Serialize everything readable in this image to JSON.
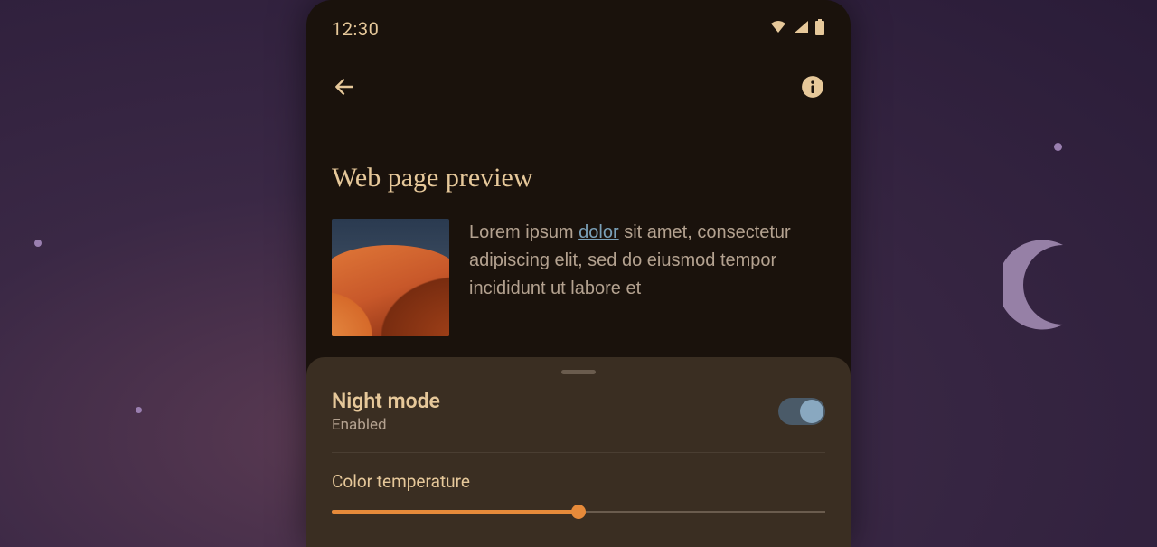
{
  "status": {
    "time": "12:30"
  },
  "page": {
    "title": "Web page preview",
    "body_pre": "Lorem ipsum ",
    "body_link": "dolor",
    "body_post": " sit amet, consectetur adipiscing elit, sed do eiusmod tempor incididunt ut labore et"
  },
  "sheet": {
    "title": "Night mode",
    "status": "Enabled",
    "toggle_on": true,
    "temp_label": "Color temperature",
    "temp_percent": 50
  },
  "icons": {
    "back": "back-arrow",
    "info": "info",
    "wifi": "wifi",
    "signal": "cellular-signal",
    "battery": "battery-full"
  },
  "colors": {
    "accent": "#e6c89a",
    "slider": "#e68a3a",
    "toggle": "#89a8c0"
  }
}
